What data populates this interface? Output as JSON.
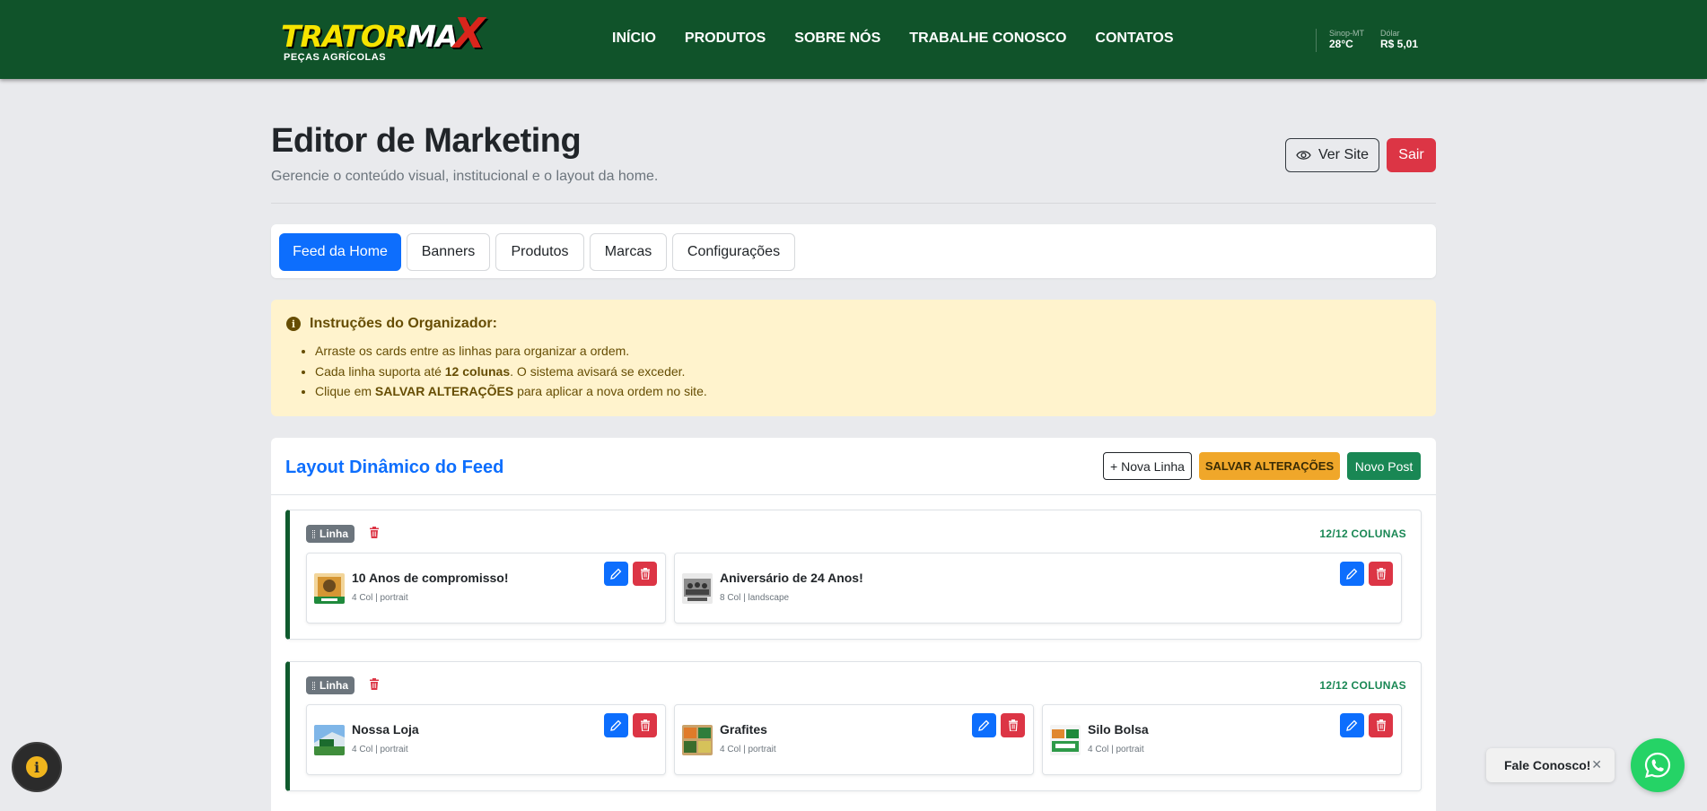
{
  "brand": {
    "logo_part1": "TRATOR",
    "logo_part2": "MA",
    "logo_x": "X",
    "logo_sub": "PEÇAS AGRÍCOLAS"
  },
  "nav": {
    "items": [
      "INÍCIO",
      "PRODUTOS",
      "SOBRE NÓS",
      "TRABALHE CONOSCO",
      "CONTATOS"
    ]
  },
  "widgets": {
    "weather_label": "Sinop-MT",
    "weather_value": "28°C",
    "dollar_label": "Dólar",
    "dollar_value": "R$ 5,01"
  },
  "header": {
    "title": "Editor de Marketing",
    "subtitle": "Gerencie o conteúdo visual, institucional e o layout da home.",
    "ver_site": "Ver Site",
    "sair": "Sair"
  },
  "tabs": [
    "Feed da Home",
    "Banners",
    "Produtos",
    "Marcas",
    "Configurações"
  ],
  "instructions": {
    "title": "Instruções do Organizador:",
    "line1": "Arraste os cards entre as linhas para organizar a ordem.",
    "line2_pre": "Cada linha suporta até ",
    "line2_bold": "12 colunas",
    "line2_post": ". O sistema avisará se exceder.",
    "line3_pre": "Clique em ",
    "line3_bold": "SALVAR ALTERAÇÕES",
    "line3_post": " para aplicar a nova ordem no site."
  },
  "feed": {
    "title": "Layout Dinâmico do Feed",
    "btn_nova_linha": "+ Nova Linha",
    "btn_salvar": "SALVAR ALTERAÇÕES",
    "btn_novo_post": "Novo Post",
    "rows": [
      {
        "badge": "Linha",
        "count": "12/12 COLUNAS",
        "cards": [
          {
            "title": "10 Anos de compromisso!",
            "meta": "4 Col | portrait"
          },
          {
            "title": "Aniversário de 24 Anos!",
            "meta": "8 Col | landscape"
          }
        ]
      },
      {
        "badge": "Linha",
        "count": "12/12 COLUNAS",
        "cards": [
          {
            "title": "Nossa Loja",
            "meta": "4 Col | portrait"
          },
          {
            "title": "Grafites",
            "meta": "4 Col | portrait"
          },
          {
            "title": "Silo Bolsa",
            "meta": "4 Col | portrait"
          }
        ]
      }
    ]
  },
  "floating": {
    "fale_conosco": "Fale Conosco!",
    "info_icon": "i"
  },
  "colors": {
    "topbar": "#10532a",
    "primary": "#0d6efd",
    "danger": "#dc3545",
    "warning": "#f0a72a",
    "success": "#198754",
    "alert_bg": "#fff3cd",
    "row_border": "#0f5a2d"
  }
}
